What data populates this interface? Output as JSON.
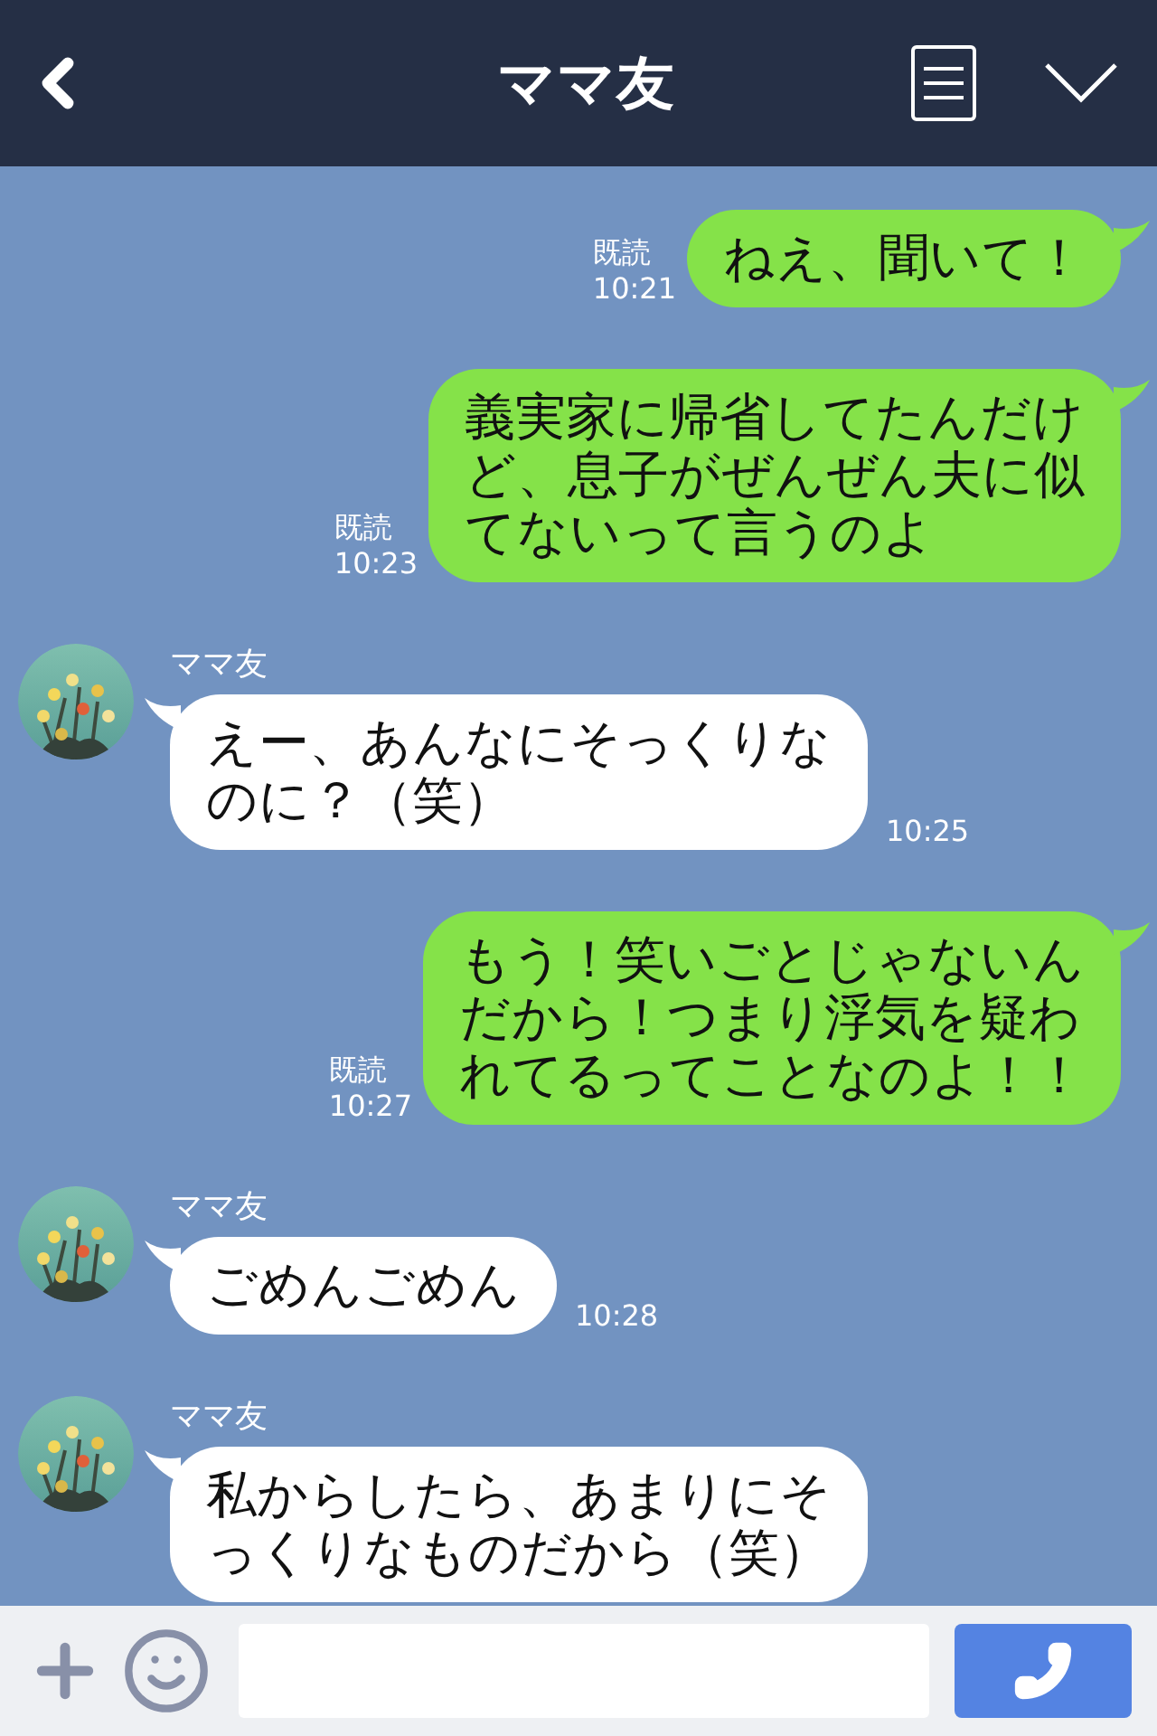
{
  "header": {
    "title": "ママ友"
  },
  "messages": [
    {
      "kind": "sent",
      "lines": [
        "ねえ、聞いて！"
      ],
      "read": "既読",
      "time": "10:21"
    },
    {
      "kind": "sent",
      "lines": [
        "義実家に帰省してたんだけ",
        "ど、息子がぜんぜん夫に似",
        "てないって言うのよ"
      ],
      "read": "既読",
      "time": "10:23"
    },
    {
      "kind": "received",
      "sender": "ママ友",
      "lines": [
        "えー、あんなにそっくりな",
        "のに？（笑）"
      ],
      "time": "10:25"
    },
    {
      "kind": "sent",
      "lines": [
        "もう！笑いごとじゃないん",
        "だから！つまり浮気を疑わ",
        "れてるってことなのよ！！"
      ],
      "read": "既読",
      "time": "10:27"
    },
    {
      "kind": "received",
      "sender": "ママ友",
      "lines": [
        "ごめんごめん"
      ],
      "time": "10:28"
    },
    {
      "kind": "received",
      "sender": "ママ友",
      "lines": [
        "私からしたら、あまりにそ",
        "っくりなものだから（笑）"
      ]
    }
  ]
}
